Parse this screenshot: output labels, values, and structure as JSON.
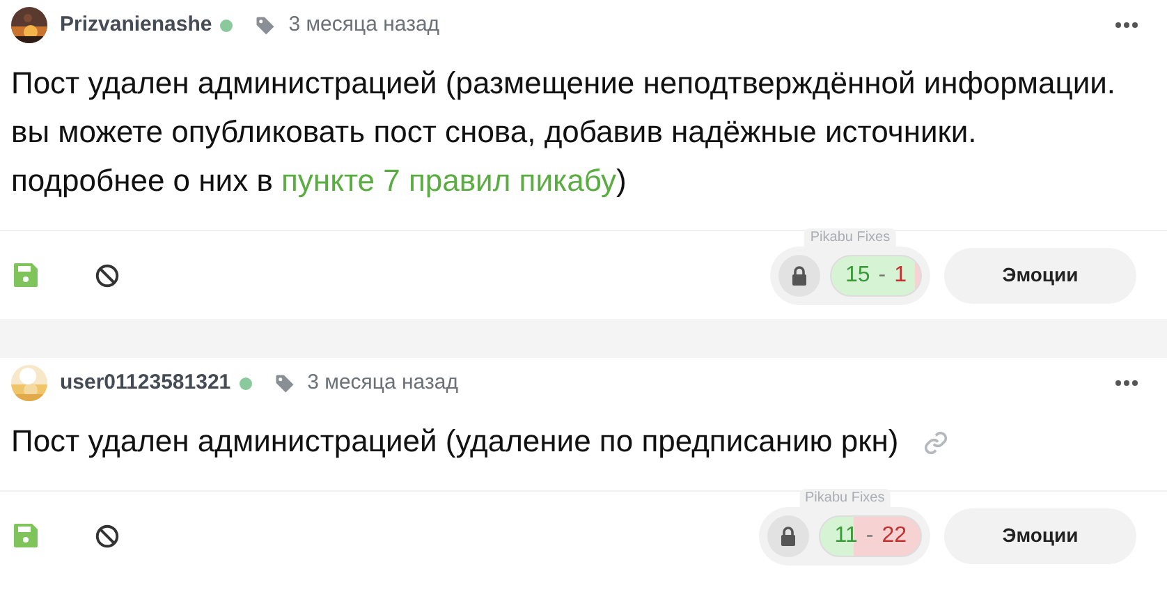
{
  "posts": [
    {
      "author": "Prizvanienashe",
      "online": true,
      "time": "3 месяца назад",
      "text": "Пост удален администрацией (размещение неподтверждённой информации. вы можете опубликовать пост снова, добавив надёжные источники. подробнее о них в ",
      "link": "пункте 7 правил пикабу",
      "text_end": ")",
      "has_link_icon": false,
      "fixes_label": "Pikabu Fixes",
      "pluses": "15",
      "separator": "-",
      "minuses": "1",
      "emotions": "Эмоции"
    },
    {
      "author": "user01123581321",
      "online": true,
      "time": "3 месяца назад",
      "text": "Пост удален администрацией (удаление по предписанию ркн)",
      "has_link_icon": true,
      "fixes_label": "Pikabu Fixes",
      "pluses": "11",
      "separator": "-",
      "minuses": "22",
      "emotions": "Эмоции"
    }
  ]
}
